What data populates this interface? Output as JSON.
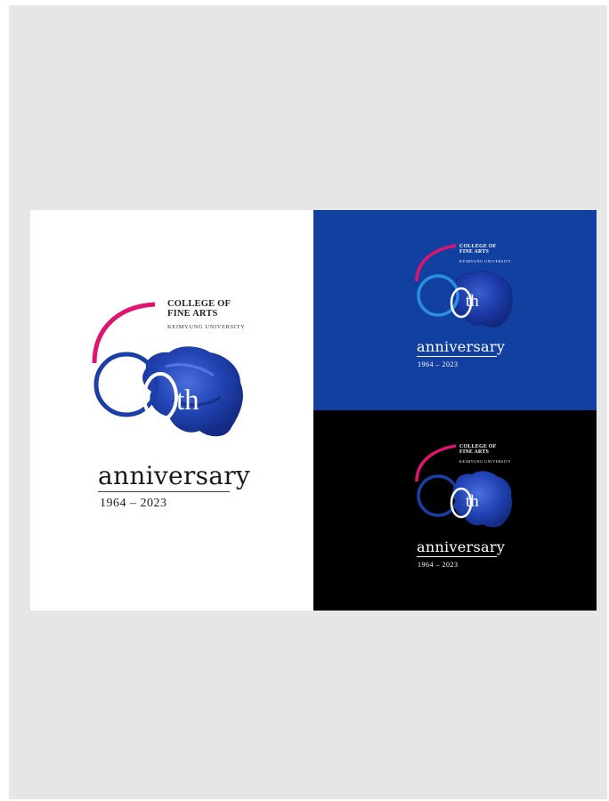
{
  "logo": {
    "college_line1": "COLLEGE OF",
    "college_line2": "FINE ARTS",
    "university": "KEIMYUNG UNIVERSITY",
    "ordinal_suffix": "th",
    "anniversary": "anniversary",
    "years": "1964 – 2023"
  },
  "colors": {
    "frame_background": "#e6e6e6",
    "panel_white": "#ffffff",
    "panel_blue": "#1240a0",
    "panel_black": "#000000",
    "arc_magenta": "#e0146e",
    "ring_blue": "#1a3fa8",
    "ring_light_blue": "#2a8fe0",
    "paint_blue": "#2346b8"
  },
  "panels": [
    {
      "name": "white-version",
      "background": "white"
    },
    {
      "name": "blue-version",
      "background": "blue"
    },
    {
      "name": "black-version",
      "background": "black"
    }
  ]
}
